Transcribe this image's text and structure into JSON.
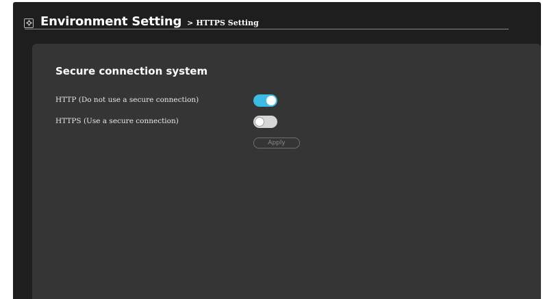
{
  "header": {
    "title": "Environment Setting",
    "separator": ">",
    "breadcrumb": "HTTPS Setting",
    "icon": "settings-icon"
  },
  "section": {
    "title": "Secure connection system"
  },
  "options": [
    {
      "label": "HTTP (Do not use a secure connection)",
      "enabled": true
    },
    {
      "label": "HTTPS (Use a secure connection)",
      "enabled": false
    }
  ],
  "apply": {
    "label": "Apply",
    "disabled": true
  },
  "colors": {
    "toggle_on": "#3dbbe5",
    "panel": "#353535",
    "window": "#1e1e1e"
  }
}
